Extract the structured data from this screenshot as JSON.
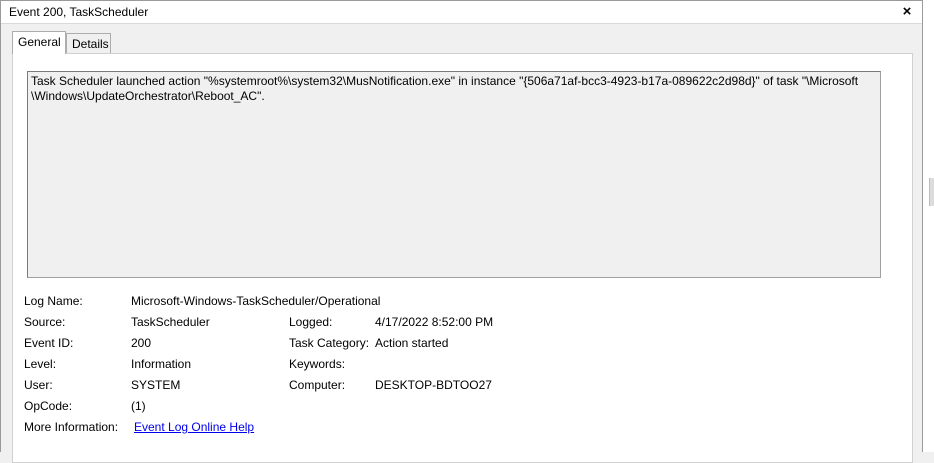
{
  "window": {
    "title": "Event 200, TaskScheduler"
  },
  "tabs": [
    {
      "label": "General",
      "active": true
    },
    {
      "label": "Details",
      "active": false
    }
  ],
  "description": "Task Scheduler launched action \"%systemroot%\\system32\\MusNotification.exe\" in instance \"{506a71af-bcc3-4923-b17a-089622c2d98d}\" of task \"\\Microsoft\n\\Windows\\UpdateOrchestrator\\Reboot_AC\".",
  "fields": {
    "log_name": {
      "label": "Log Name:",
      "value": "Microsoft-Windows-TaskScheduler/Operational"
    },
    "source": {
      "label": "Source:",
      "value": "TaskScheduler"
    },
    "logged": {
      "label": "Logged:",
      "value": "4/17/2022 8:52:00 PM"
    },
    "event_id": {
      "label": "Event ID:",
      "value": "200"
    },
    "task_category": {
      "label": "Task Category:",
      "value": "Action started"
    },
    "level": {
      "label": "Level:",
      "value": "Information"
    },
    "keywords": {
      "label": "Keywords:",
      "value": ""
    },
    "user": {
      "label": "User:",
      "value": "SYSTEM"
    },
    "computer": {
      "label": "Computer:",
      "value": "DESKTOP-BDTOO27"
    },
    "opcode": {
      "label": "OpCode:",
      "value": "(1)"
    },
    "more_info": {
      "label": "More Information:",
      "link": "Event Log Online Help"
    }
  },
  "icons": {
    "close": "×"
  }
}
